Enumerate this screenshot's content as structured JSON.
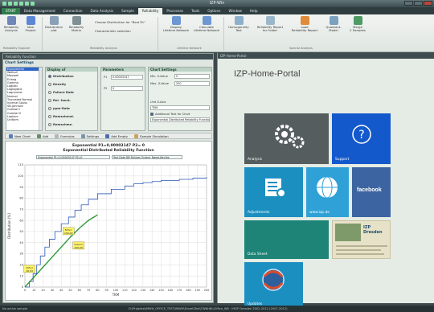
{
  "window": {
    "title": "IZP-Win"
  },
  "ribbon_tabs": [
    "START",
    "Data Management",
    "Connection",
    "Data Analysis",
    "Sample",
    "Reliability",
    "Processes",
    "Tools",
    "Options",
    "Window",
    "Help"
  ],
  "ribbon": {
    "buttons": [
      {
        "label": "Reliability\nAnalysis"
      },
      {
        "label": "New\nProject"
      },
      {
        "label": "Distribution\nplot"
      },
      {
        "label": "Reliability Matrix"
      },
      {
        "label": "Display\nLifetime Network"
      },
      {
        "label": "Calculate\nLifetime Network"
      },
      {
        "label": "Homogeneity\nTest"
      },
      {
        "label": "Reliability Report\nfor Folder"
      },
      {
        "label": "Load\nReliability Report"
      },
      {
        "label": "Quadrant-\nModel"
      },
      {
        "label": "Merge\n2 Samples"
      }
    ],
    "choose_dist": "Choose Distribution for \"Best Fit\"",
    "char_sel": "Characteristic selection",
    "groups": [
      "Reliability Explorer",
      "Reliability Analysis",
      "Lifetime Network",
      "Special Analysis"
    ]
  },
  "left_pane": {
    "title": "Reliability Function",
    "chart_settings_head": "Chart Settings",
    "distributions": [
      "Exponential",
      "Weibull",
      "Maxwell",
      "Erlang",
      "Gamma",
      "Logistic",
      "Loglogistic",
      "Lognormal",
      "Normal",
      "Truncated Normal",
      "Inverse Gauss",
      "SB-Johnson",
      "Gumbel I",
      "Gumbel II",
      "Laplace",
      "Uniform"
    ],
    "display_head": "Display of",
    "display_opts": [
      "Distribution",
      "Density",
      "Failure Rate",
      "Rel. funct.",
      "ppm-Rate",
      "Remschend.",
      "Remschme."
    ],
    "params_head": "Parameters",
    "p1_label": "P1",
    "p1_value": "0.00003147",
    "p2_label": "P2",
    "p2_value": "0",
    "chartset_head": "Chart Settings",
    "min_x_label": "Min. X-Value",
    "min_x_value": "0",
    "max_x_label": "Max. X-Value",
    "max_x_value": "200",
    "unit_label": "Unit X-Axis",
    "unit_value": "TKM",
    "additional": "Additional Text for Chart",
    "additional_value": "Exponential Distributed Reliability Function",
    "toolbar": [
      "New Chart",
      "Add",
      "Formulas",
      "Settings",
      "Add Empty",
      "Sample Simulation"
    ]
  },
  "chart_data": {
    "type": "line",
    "title": "Exponential P1=0,00003147 P2= 0",
    "subtitle": "Exponential Distributed Reliability Function",
    "selector_1": "Exponential P1=0,00003147 P2=0",
    "selector_2": "Test Data DB Failures_Engine_Name-Key.fex",
    "xlabel": "TKM",
    "ylabel": "Distribution [%]",
    "xlim": [
      0,
      200
    ],
    "ylim": [
      0,
      110
    ],
    "x_ticks": [
      "0",
      "10",
      "20",
      "30",
      "40",
      "50",
      "60",
      "70",
      "80",
      "90",
      "100",
      "110",
      "120",
      "130",
      "140",
      "150",
      "160",
      "170",
      "180",
      "190",
      "200"
    ],
    "y_ticks": [
      "0",
      "10",
      "20",
      "30",
      "40",
      "50",
      "60",
      "70",
      "80",
      "90",
      "100",
      "110"
    ],
    "series": [
      {
        "x": [
          0,
          10,
          20,
          30,
          40,
          50,
          60,
          70,
          80
        ],
        "y": [
          0,
          9,
          18,
          27,
          36,
          45,
          53,
          60,
          65
        ]
      },
      {
        "x": [
          0,
          5,
          9,
          13,
          17,
          22,
          27,
          33,
          40,
          48,
          55,
          62,
          70,
          80,
          95,
          110,
          120,
          130,
          140,
          150,
          160,
          170,
          185,
          200
        ],
        "y": [
          0,
          5,
          12,
          20,
          28,
          36,
          43,
          50,
          57,
          63,
          69,
          74,
          79,
          84,
          88,
          91,
          93,
          94,
          95,
          96,
          96,
          97,
          98,
          99
        ]
      }
    ],
    "annotations": [
      {
        "text": "50%=\n100,00",
        "x": 48,
        "y": 50
      },
      {
        "text": "mean=\n100,00",
        "x": 59,
        "y": 37
      },
      {
        "text": "10%=\n10,53",
        "x": 5,
        "y": 16
      }
    ],
    "grid": true
  },
  "right_pane": {
    "title": "IZP-Home-Portal",
    "heading": "IZP-Home-Portal",
    "tiles": [
      {
        "label": "Analysis",
        "color": "#565d5e"
      },
      {
        "label": "Support",
        "color": "#1459cc"
      },
      {
        "label": "Adjustments",
        "color": "#1c8fc1"
      },
      {
        "label": "www.izp.de",
        "color": "#2fa1d6"
      },
      {
        "label": "facebook",
        "color": "#3c64a0"
      },
      {
        "label": "Data Sheet",
        "color": "#1d8477"
      },
      {
        "label": "IZP Dresden",
        "color": "#e6e2c8"
      },
      {
        "label": "Updates",
        "color": "#1c8fc1"
      }
    ],
    "izp_tile_text": "IZP Dresden"
  },
  "status": {
    "text": "No active sample",
    "path": "D:\\Projekte\\IMWH_OFFICE_TEST\\IMWH\\Einzel\\Test\\TWNHBL\\Office_WB · IMZP Dresden 2002-2012 (2007-2012)"
  }
}
